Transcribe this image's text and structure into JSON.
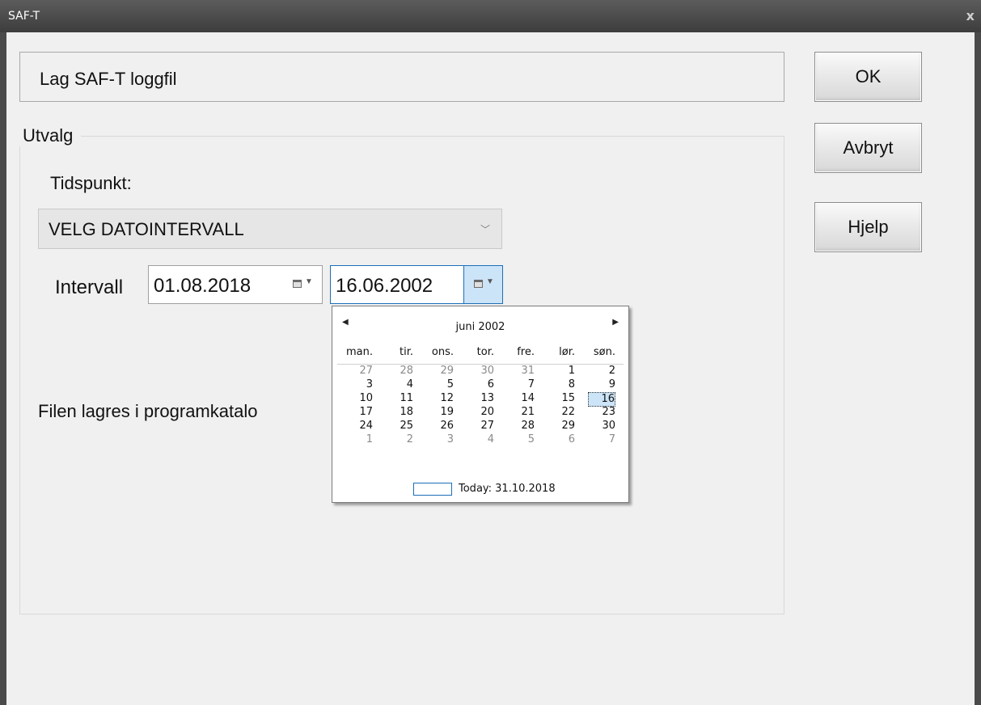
{
  "window": {
    "title": "SAF-T",
    "close_glyph": "x"
  },
  "header": {
    "label": "Lag SAF-T loggfil"
  },
  "buttons": {
    "ok": "OK",
    "cancel": "Avbryt",
    "help": "Hjelp"
  },
  "group": {
    "label": "Utvalg",
    "tidspunkt_label": "Tidspunkt:",
    "tidspunkt_value": "VELG DATOINTERVALL",
    "tidspunkt_arrow": "﹀",
    "intervall_label": "Intervall",
    "date_from": "01.08.2018",
    "date_to": "16.06.2002",
    "file_text": "Filen lagres i programkatalo"
  },
  "calendar": {
    "month_label": "juni 2002",
    "prev_glyph": "◀",
    "next_glyph": "▶",
    "weekdays": [
      "man.",
      "tir.",
      "ons.",
      "tor.",
      "fre.",
      "lør.",
      "søn."
    ],
    "weeks": [
      [
        {
          "d": "27",
          "dim": true
        },
        {
          "d": "28",
          "dim": true
        },
        {
          "d": "29",
          "dim": true
        },
        {
          "d": "30",
          "dim": true
        },
        {
          "d": "31",
          "dim": true
        },
        {
          "d": "1"
        },
        {
          "d": "2"
        }
      ],
      [
        {
          "d": "3"
        },
        {
          "d": "4"
        },
        {
          "d": "5"
        },
        {
          "d": "6"
        },
        {
          "d": "7"
        },
        {
          "d": "8"
        },
        {
          "d": "9"
        }
      ],
      [
        {
          "d": "10"
        },
        {
          "d": "11"
        },
        {
          "d": "12"
        },
        {
          "d": "13"
        },
        {
          "d": "14"
        },
        {
          "d": "15"
        },
        {
          "d": "16",
          "sel": true
        }
      ],
      [
        {
          "d": "17"
        },
        {
          "d": "18"
        },
        {
          "d": "19"
        },
        {
          "d": "20"
        },
        {
          "d": "21"
        },
        {
          "d": "22"
        },
        {
          "d": "23"
        }
      ],
      [
        {
          "d": "24"
        },
        {
          "d": "25"
        },
        {
          "d": "26"
        },
        {
          "d": "27"
        },
        {
          "d": "28"
        },
        {
          "d": "29"
        },
        {
          "d": "30"
        }
      ],
      [
        {
          "d": "1",
          "dim": true
        },
        {
          "d": "2",
          "dim": true
        },
        {
          "d": "3",
          "dim": true
        },
        {
          "d": "4",
          "dim": true
        },
        {
          "d": "5",
          "dim": true
        },
        {
          "d": "6",
          "dim": true
        },
        {
          "d": "7",
          "dim": true
        }
      ]
    ],
    "today_label": "Today: 31.10.2018"
  }
}
